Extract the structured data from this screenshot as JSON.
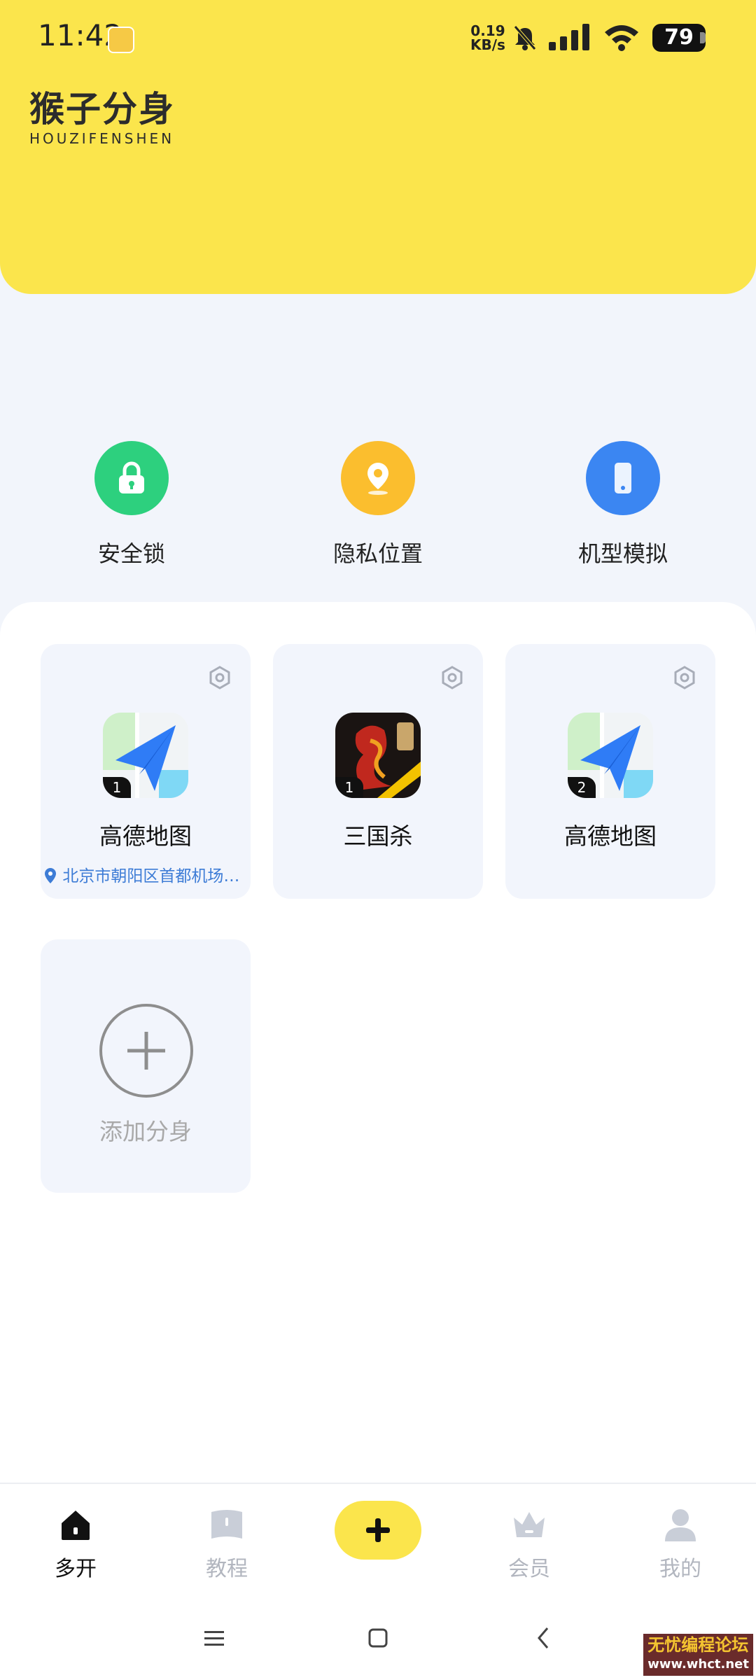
{
  "status_bar": {
    "time": "11:42",
    "net_speed_value": "0.19",
    "net_speed_unit": "KB/s",
    "battery": "79"
  },
  "header": {
    "logo_cn": "猴子分身",
    "logo_en": "HOUZIFENSHEN",
    "bg_color": "#FBE54C"
  },
  "features": [
    {
      "label": "安全锁",
      "icon": "lock-icon",
      "color": "#2DD07E"
    },
    {
      "label": "隐私位置",
      "icon": "location-pin-icon",
      "color": "#FBBE2E"
    },
    {
      "label": "机型模拟",
      "icon": "phone-icon",
      "color": "#3B86F2"
    }
  ],
  "apps": [
    {
      "name": "高德地图",
      "badge": "1",
      "location": "北京市朝阳区首都机场…",
      "icon": "amap-icon"
    },
    {
      "name": "三国杀",
      "badge": "1",
      "location": "",
      "icon": "sanguosha-icon"
    },
    {
      "name": "高德地图",
      "badge": "2",
      "location": "",
      "icon": "amap-icon"
    }
  ],
  "add_card": {
    "label": "添加分身"
  },
  "bottom_nav": [
    {
      "label": "多开",
      "icon": "home-icon",
      "active": true
    },
    {
      "label": "教程",
      "icon": "book-icon",
      "active": false
    },
    {
      "label": "",
      "icon": "plus-icon",
      "active": false
    },
    {
      "label": "会员",
      "icon": "crown-icon",
      "active": false
    },
    {
      "label": "我的",
      "icon": "person-icon",
      "active": false
    }
  ],
  "watermark": {
    "text": "无忧编程论坛",
    "url": "www.whct.net"
  }
}
